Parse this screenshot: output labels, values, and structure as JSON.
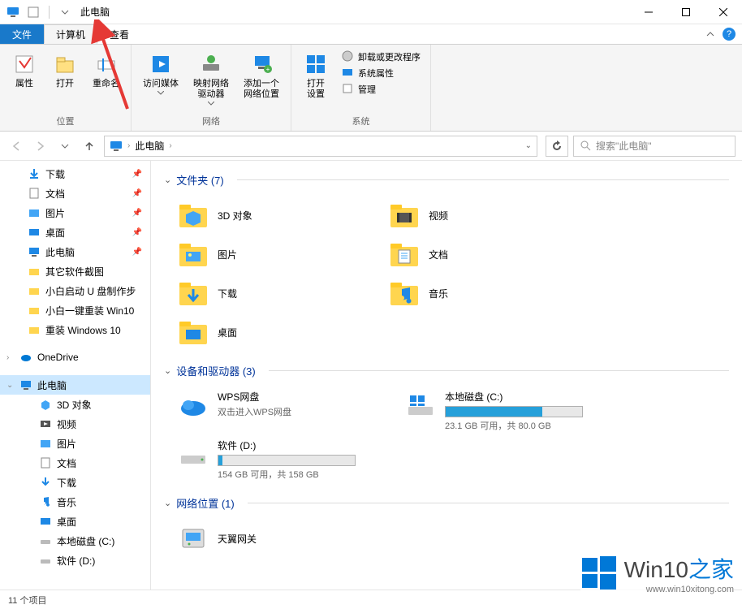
{
  "window": {
    "title": "此电脑"
  },
  "tabs": {
    "file": "文件",
    "computer": "计算机",
    "view": "查看"
  },
  "ribbon": {
    "group1": {
      "label": "位置",
      "items": [
        {
          "label": "属性"
        },
        {
          "label": "打开"
        },
        {
          "label": "重命名"
        }
      ]
    },
    "group2": {
      "label": "网络",
      "items": [
        {
          "label": "访问媒体\n"
        },
        {
          "label": "映射网络\n驱动器"
        },
        {
          "label": "添加一个\n网络位置"
        }
      ]
    },
    "group3": {
      "label": "系统",
      "open_settings": "打开\n设置",
      "small": [
        {
          "label": "卸载或更改程序"
        },
        {
          "label": "系统属性"
        },
        {
          "label": "管理"
        }
      ]
    }
  },
  "navbar": {
    "address": "此电脑",
    "search_placeholder": "搜索\"此电脑\""
  },
  "sidebar": {
    "items": [
      {
        "label": "下载",
        "pin": true
      },
      {
        "label": "文档",
        "pin": true
      },
      {
        "label": "图片",
        "pin": true
      },
      {
        "label": "桌面",
        "pin": true
      },
      {
        "label": "此电脑",
        "pin": true
      },
      {
        "label": "其它软件截图"
      },
      {
        "label": "小白启动 U 盘制作步"
      },
      {
        "label": "小白一键重装 Win10"
      },
      {
        "label": "重装 Windows 10"
      }
    ],
    "onedrive": "OneDrive",
    "thispc": "此电脑",
    "thispc_items": [
      {
        "label": "3D 对象"
      },
      {
        "label": "视频"
      },
      {
        "label": "图片"
      },
      {
        "label": "文档"
      },
      {
        "label": "下载"
      },
      {
        "label": "音乐"
      },
      {
        "label": "桌面"
      },
      {
        "label": "本地磁盘 (C:)"
      },
      {
        "label": "软件 (D:)"
      }
    ]
  },
  "content": {
    "folders_header": "文件夹 (7)",
    "folders": [
      {
        "label": "3D 对象"
      },
      {
        "label": "视频"
      },
      {
        "label": "图片"
      },
      {
        "label": "文档"
      },
      {
        "label": "下载"
      },
      {
        "label": "音乐"
      },
      {
        "label": "桌面"
      }
    ],
    "drives_header": "设备和驱动器 (3)",
    "drives_wps_title": "WPS网盘",
    "drives_wps_sub": "双击进入WPS网盘",
    "drives_c_title": "本地磁盘 (C:)",
    "drives_c_sub": "23.1 GB 可用，共 80.0 GB",
    "drives_c_fill": 71,
    "drives_d_title": "软件 (D:)",
    "drives_d_sub": "154 GB 可用，共 158 GB",
    "drives_d_fill": 3,
    "netloc_header": "网络位置 (1)",
    "netloc_item": "天翼网关"
  },
  "statusbar": {
    "text": "11 个项目"
  },
  "watermark": {
    "brand1": "Win10",
    "brand2": "之家",
    "url": "www.win10xitong.com"
  }
}
